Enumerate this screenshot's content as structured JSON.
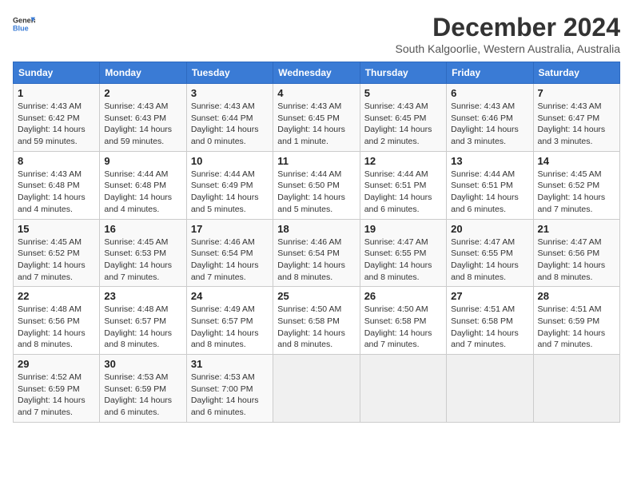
{
  "header": {
    "logo_general": "General",
    "logo_blue": "Blue",
    "main_title": "December 2024",
    "subtitle": "South Kalgoorlie, Western Australia, Australia"
  },
  "days_of_week": [
    "Sunday",
    "Monday",
    "Tuesday",
    "Wednesday",
    "Thursday",
    "Friday",
    "Saturday"
  ],
  "weeks": [
    [
      {
        "day": 1,
        "sunrise": "4:43 AM",
        "sunset": "6:42 PM",
        "daylight": "14 hours and 59 minutes"
      },
      {
        "day": 2,
        "sunrise": "4:43 AM",
        "sunset": "6:43 PM",
        "daylight": "14 hours and 59 minutes"
      },
      {
        "day": 3,
        "sunrise": "4:43 AM",
        "sunset": "6:44 PM",
        "daylight": "14 hours and 0 minutes"
      },
      {
        "day": 4,
        "sunrise": "4:43 AM",
        "sunset": "6:45 PM",
        "daylight": "14 hours and 1 minute"
      },
      {
        "day": 5,
        "sunrise": "4:43 AM",
        "sunset": "6:45 PM",
        "daylight": "14 hours and 2 minutes"
      },
      {
        "day": 6,
        "sunrise": "4:43 AM",
        "sunset": "6:46 PM",
        "daylight": "14 hours and 3 minutes"
      },
      {
        "day": 7,
        "sunrise": "4:43 AM",
        "sunset": "6:47 PM",
        "daylight": "14 hours and 3 minutes"
      }
    ],
    [
      {
        "day": 8,
        "sunrise": "4:43 AM",
        "sunset": "6:48 PM",
        "daylight": "14 hours and 4 minutes"
      },
      {
        "day": 9,
        "sunrise": "4:44 AM",
        "sunset": "6:48 PM",
        "daylight": "14 hours and 4 minutes"
      },
      {
        "day": 10,
        "sunrise": "4:44 AM",
        "sunset": "6:49 PM",
        "daylight": "14 hours and 5 minutes"
      },
      {
        "day": 11,
        "sunrise": "4:44 AM",
        "sunset": "6:50 PM",
        "daylight": "14 hours and 5 minutes"
      },
      {
        "day": 12,
        "sunrise": "4:44 AM",
        "sunset": "6:51 PM",
        "daylight": "14 hours and 6 minutes"
      },
      {
        "day": 13,
        "sunrise": "4:44 AM",
        "sunset": "6:51 PM",
        "daylight": "14 hours and 6 minutes"
      },
      {
        "day": 14,
        "sunrise": "4:45 AM",
        "sunset": "6:52 PM",
        "daylight": "14 hours and 7 minutes"
      }
    ],
    [
      {
        "day": 15,
        "sunrise": "4:45 AM",
        "sunset": "6:52 PM",
        "daylight": "14 hours and 7 minutes"
      },
      {
        "day": 16,
        "sunrise": "4:45 AM",
        "sunset": "6:53 PM",
        "daylight": "14 hours and 7 minutes"
      },
      {
        "day": 17,
        "sunrise": "4:46 AM",
        "sunset": "6:54 PM",
        "daylight": "14 hours and 7 minutes"
      },
      {
        "day": 18,
        "sunrise": "4:46 AM",
        "sunset": "6:54 PM",
        "daylight": "14 hours and 8 minutes"
      },
      {
        "day": 19,
        "sunrise": "4:47 AM",
        "sunset": "6:55 PM",
        "daylight": "14 hours and 8 minutes"
      },
      {
        "day": 20,
        "sunrise": "4:47 AM",
        "sunset": "6:55 PM",
        "daylight": "14 hours and 8 minutes"
      },
      {
        "day": 21,
        "sunrise": "4:47 AM",
        "sunset": "6:56 PM",
        "daylight": "14 hours and 8 minutes"
      }
    ],
    [
      {
        "day": 22,
        "sunrise": "4:48 AM",
        "sunset": "6:56 PM",
        "daylight": "14 hours and 8 minutes"
      },
      {
        "day": 23,
        "sunrise": "4:48 AM",
        "sunset": "6:57 PM",
        "daylight": "14 hours and 8 minutes"
      },
      {
        "day": 24,
        "sunrise": "4:49 AM",
        "sunset": "6:57 PM",
        "daylight": "14 hours and 8 minutes"
      },
      {
        "day": 25,
        "sunrise": "4:50 AM",
        "sunset": "6:58 PM",
        "daylight": "14 hours and 8 minutes"
      },
      {
        "day": 26,
        "sunrise": "4:50 AM",
        "sunset": "6:58 PM",
        "daylight": "14 hours and 7 minutes"
      },
      {
        "day": 27,
        "sunrise": "4:51 AM",
        "sunset": "6:58 PM",
        "daylight": "14 hours and 7 minutes"
      },
      {
        "day": 28,
        "sunrise": "4:51 AM",
        "sunset": "6:59 PM",
        "daylight": "14 hours and 7 minutes"
      }
    ],
    [
      {
        "day": 29,
        "sunrise": "4:52 AM",
        "sunset": "6:59 PM",
        "daylight": "14 hours and 7 minutes"
      },
      {
        "day": 30,
        "sunrise": "4:53 AM",
        "sunset": "6:59 PM",
        "daylight": "14 hours and 6 minutes"
      },
      {
        "day": 31,
        "sunrise": "4:53 AM",
        "sunset": "7:00 PM",
        "daylight": "14 hours and 6 minutes"
      },
      null,
      null,
      null,
      null
    ]
  ]
}
